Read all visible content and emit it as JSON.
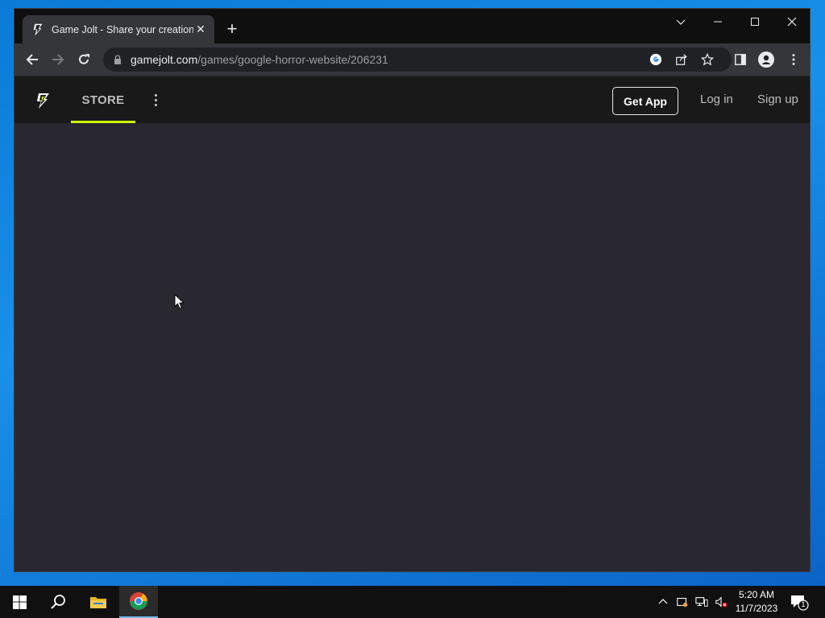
{
  "browser": {
    "tab_title": "Game Jolt - Share your creations",
    "url_host": "gamejolt.com",
    "url_path": "/games/google-horror-website/206231"
  },
  "site": {
    "nav_store": "STORE",
    "get_app": "Get App",
    "log_in": "Log in",
    "sign_up": "Sign up",
    "accent_color": "#ccff00",
    "bg_color": "#292730"
  },
  "taskbar": {
    "time": "5:20 AM",
    "date": "11/7/2023",
    "notification_count": "1",
    "apps": [
      "start-icon",
      "search-icon",
      "file-explorer-icon",
      "chrome-icon"
    ]
  }
}
